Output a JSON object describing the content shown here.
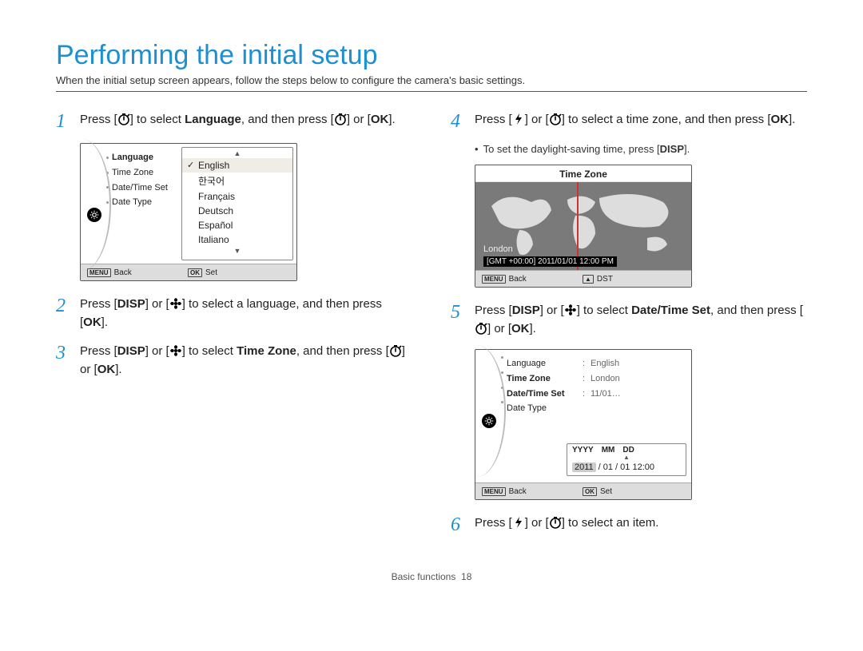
{
  "title": "Performing the initial setup",
  "subtitle": "When the initial setup screen appears, follow the steps below to configure the camera's basic settings.",
  "steps": {
    "s1": {
      "num": "1",
      "a": "Press [",
      "b": "] to select ",
      "c": "Language",
      "d": ", and then press [",
      "e": "] or [",
      "f": "]."
    },
    "s2": {
      "num": "2",
      "a": "Press [",
      "b": "] or [",
      "c": "] to select a language, and then press [",
      "d": "]."
    },
    "s3": {
      "num": "3",
      "a": "Press [",
      "b": "] or [",
      "c": "] to select ",
      "d": "Time Zone",
      "e": ", and then press [",
      "f": "] or [",
      "g": "]."
    },
    "s4": {
      "num": "4",
      "a": "Press [",
      "b": "] or [",
      "c": "] to select a time zone, and then press [",
      "d": "]."
    },
    "s4_note": "To set the daylight-saving time, press [",
    "s4_note_end": "].",
    "s5": {
      "num": "5",
      "a": "Press [",
      "b": "] or [",
      "c": "] to select ",
      "d": "Date/Time Set",
      "e": ", and then press [",
      "f": "] or [",
      "g": "]."
    },
    "s6": {
      "num": "6",
      "a": "Press [",
      "b": "] or [",
      "c": "] to select an item."
    }
  },
  "lcd_lang": {
    "menu": [
      "Language",
      "Time Zone",
      "Date/Time Set",
      "Date Type"
    ],
    "options": [
      "English",
      "한국어",
      "Français",
      "Deutsch",
      "Español",
      "Italiano"
    ],
    "bar_left_icon": "MENU",
    "bar_left": "Back",
    "bar_right_icon": "OK",
    "bar_right": "Set"
  },
  "lcd_tz": {
    "title": "Time Zone",
    "city": "London",
    "datetime": "[GMT +00:00] 2011/01/01 12:00 PM",
    "bar_left_icon": "MENU",
    "bar_left": "Back",
    "bar_right_icon": "▲",
    "bar_right": "DST"
  },
  "lcd_dt": {
    "rows": [
      {
        "k": "Language",
        "v": "English"
      },
      {
        "k": "Time Zone",
        "v": "London"
      },
      {
        "k": "Date/Time Set",
        "v": "11/01…"
      },
      {
        "k": "Date Type",
        "v": ""
      }
    ],
    "editor_hdr": [
      "YYYY",
      "MM",
      "DD"
    ],
    "editor_val": {
      "y": "2011",
      "rest": "/ 01 / 01 12:00"
    },
    "bar_left_icon": "MENU",
    "bar_left": "Back",
    "bar_right_icon": "OK",
    "bar_right": "Set"
  },
  "footer": {
    "section": "Basic functions",
    "page": "18"
  },
  "icons": {
    "DISP": "DISP",
    "OK": "OK"
  }
}
